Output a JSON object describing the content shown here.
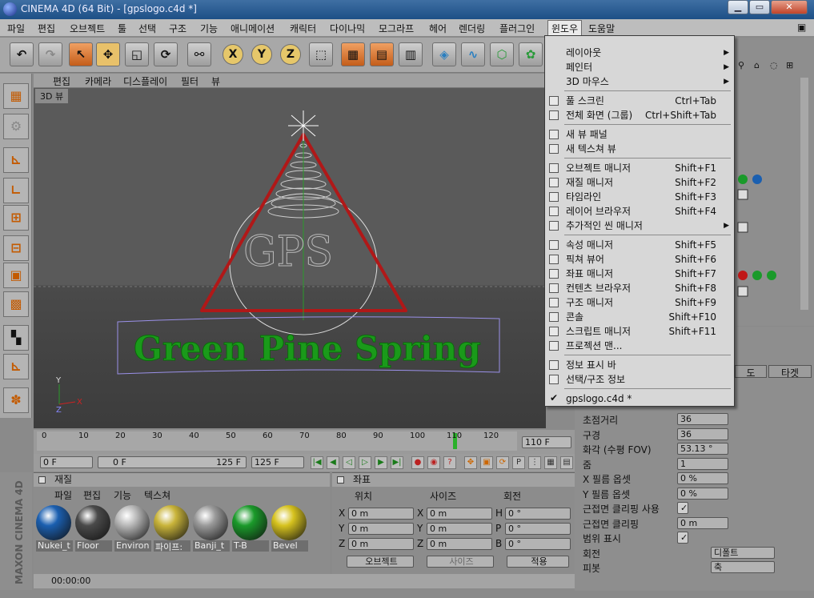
{
  "window": {
    "title": "CINEMA 4D (64 Bit) - [gpslogo.c4d *]"
  },
  "menubar": [
    "파일",
    "편집",
    "오브젝트",
    "툴",
    "선택",
    "구조",
    "기능",
    "애니메이션",
    "캐릭터",
    "다이나믹",
    "모그라프",
    "헤어",
    "렌더링",
    "플러그인",
    "윈도우",
    "도움말"
  ],
  "viewport_menu": [
    "편집",
    "카메라",
    "디스플레이",
    "필터",
    "뷰"
  ],
  "viewport": {
    "tag": "3D 뷰",
    "scene_text": "Green Pine Spring",
    "logo": "GPS"
  },
  "timeline": {
    "ticks": [
      "0",
      "10",
      "20",
      "30",
      "40",
      "50",
      "60",
      "70",
      "80",
      "90",
      "100",
      "110",
      "120"
    ],
    "current": "110",
    "end_field": "110 F"
  },
  "playbar": {
    "start": "0 F",
    "range_start": "0 F",
    "range_end": "125 F",
    "end": "125 F"
  },
  "materials": {
    "title": "재질",
    "menu": [
      "파일",
      "편집",
      "기능",
      "텍스쳐"
    ],
    "items": [
      {
        "name": "Nukei_t",
        "color": "#1b5fb0"
      },
      {
        "name": "Floor",
        "color": "#4a4a4a"
      },
      {
        "name": "Environ",
        "color": "#b8b8b8"
      },
      {
        "name": "파이프:",
        "color": "#c9b43a"
      },
      {
        "name": "Banji_t",
        "color": "#9a9a9a"
      },
      {
        "name": "T-B",
        "color": "#1a9a2a"
      },
      {
        "name": "Bevel",
        "color": "#d6c21e"
      }
    ]
  },
  "coords": {
    "title": "좌표",
    "headers": [
      "위치",
      "사이즈",
      "회전"
    ],
    "rows": [
      {
        "a": "X",
        "av": "0 m",
        "b": "X",
        "bv": "0 m",
        "c": "H",
        "cv": "0 °"
      },
      {
        "a": "Y",
        "av": "0 m",
        "b": "Y",
        "bv": "0 m",
        "c": "P",
        "cv": "0 °"
      },
      {
        "a": "Z",
        "av": "0 m",
        "b": "Z",
        "bv": "0 m",
        "c": "B",
        "cv": "0 °"
      }
    ],
    "mode1": "오브젝트",
    "mode2": "사이즈",
    "apply": "적용"
  },
  "status": {
    "time": "00:00:00"
  },
  "attributes": {
    "tabs": [
      "도",
      "타겟"
    ],
    "rows": [
      {
        "label": "초점거리",
        "value": "36"
      },
      {
        "label": "구경",
        "value": "36"
      },
      {
        "label": "화각 (수평 FOV)",
        "value": "53.13 °"
      },
      {
        "label": "줌",
        "value": "1"
      },
      {
        "label": "X 필름 옵셋",
        "value": "0 %"
      },
      {
        "label": "Y 필름 옵셋",
        "value": "0 %"
      },
      {
        "label": "근접면 클리핑 사용",
        "value": "✓"
      },
      {
        "label": "근접면 클리핑",
        "value": "0 m"
      },
      {
        "label": "범위 표시",
        "value": "✓"
      },
      {
        "label": "회전",
        "value": "디폴트"
      },
      {
        "label": "피봇",
        "value": "축"
      }
    ]
  },
  "dropdown": [
    {
      "label": "레이아웃",
      "sc": "",
      "sub": true,
      "sep": false
    },
    {
      "label": "페인터",
      "sc": "",
      "sub": true,
      "sep": false
    },
    {
      "label": "3D 마우스",
      "sc": "",
      "sub": true,
      "sep": true
    },
    {
      "label": "풀 스크린",
      "sc": "Ctrl+Tab",
      "sub": false,
      "sep": false
    },
    {
      "label": "전체 화면 (그룹)",
      "sc": "Ctrl+Shift+Tab",
      "sub": false,
      "sep": true
    },
    {
      "label": "새 뷰 패널",
      "sc": "",
      "sub": false,
      "sep": false
    },
    {
      "label": "새 텍스쳐 뷰",
      "sc": "",
      "sub": false,
      "sep": true
    },
    {
      "label": "오브젝트 매니저",
      "sc": "Shift+F1",
      "sub": false,
      "sep": false
    },
    {
      "label": "재질 매니저",
      "sc": "Shift+F2",
      "sub": false,
      "sep": false
    },
    {
      "label": "타임라인",
      "sc": "Shift+F3",
      "sub": false,
      "sep": false
    },
    {
      "label": "레이어 브라우저",
      "sc": "Shift+F4",
      "sub": false,
      "sep": false
    },
    {
      "label": "추가적인 씬 매니저",
      "sc": "",
      "sub": true,
      "sep": true
    },
    {
      "label": "속성 매니저",
      "sc": "Shift+F5",
      "sub": false,
      "sep": false
    },
    {
      "label": "픽쳐 뷰어",
      "sc": "Shift+F6",
      "sub": false,
      "sep": false
    },
    {
      "label": "좌표 매니저",
      "sc": "Shift+F7",
      "sub": false,
      "sep": false
    },
    {
      "label": "컨텐츠 브라우저",
      "sc": "Shift+F8",
      "sub": false,
      "sep": false
    },
    {
      "label": "구조 매니저",
      "sc": "Shift+F9",
      "sub": false,
      "sep": false
    },
    {
      "label": "콘솔",
      "sc": "Shift+F10",
      "sub": false,
      "sep": false
    },
    {
      "label": "스크립트 매니저",
      "sc": "Shift+F11",
      "sub": false,
      "sep": false
    },
    {
      "label": "프로젝션 맨...",
      "sc": "",
      "sub": false,
      "sep": true
    },
    {
      "label": "정보 표시 바",
      "sc": "",
      "sub": false,
      "sep": false
    },
    {
      "label": "선택/구조 정보",
      "sc": "",
      "sub": false,
      "sep": true
    },
    {
      "label": "gpslogo.c4d *",
      "sc": "",
      "sub": false,
      "sep": false,
      "check": true
    }
  ]
}
